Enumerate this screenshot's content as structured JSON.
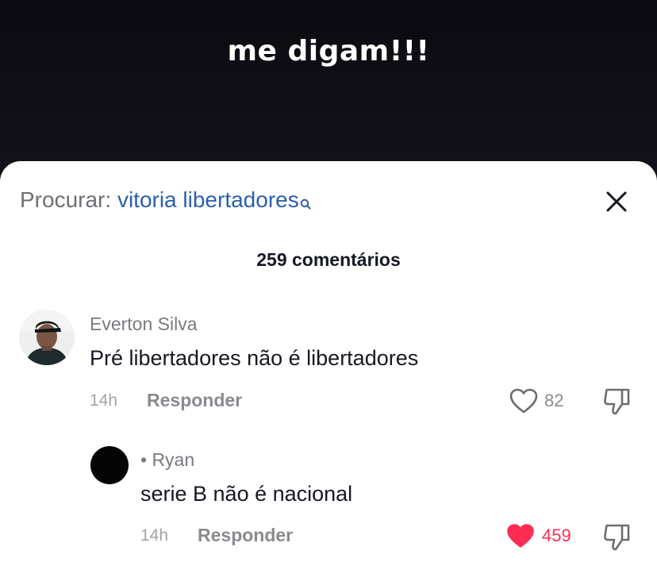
{
  "video": {
    "caption": "me digam!!!"
  },
  "search": {
    "prefix": "Procurar:",
    "term": "vitoria libertadores",
    "icon": "search-icon"
  },
  "comments_header": {
    "count_label": "259 comentários"
  },
  "comments": [
    {
      "username": "Everton Silva",
      "text": "Pré libertadores não é libertadores",
      "time": "14h",
      "reply_label": "Responder",
      "likes": "82",
      "liked": false
    },
    {
      "username": "• Ryan",
      "text": "serie B não é nacional",
      "time": "14h",
      "reply_label": "Responder",
      "likes": "459",
      "liked": true
    }
  ],
  "colors": {
    "accent_link": "#2b5fad",
    "liked_red": "#fe2c55",
    "text_primary": "#161823",
    "text_muted": "#7a7a80"
  }
}
